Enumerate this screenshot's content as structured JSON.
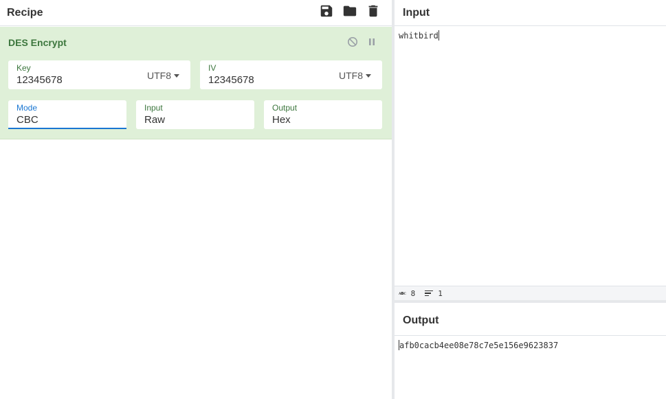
{
  "recipe": {
    "title": "Recipe",
    "icons": [
      "save-icon",
      "folder-icon",
      "trash-icon"
    ]
  },
  "operation": {
    "name": "DES Encrypt",
    "key": {
      "label": "Key",
      "value": "12345678",
      "encoding": "UTF8"
    },
    "iv": {
      "label": "IV",
      "value": "12345678",
      "encoding": "UTF8"
    },
    "mode": {
      "label": "Mode",
      "value": "CBC"
    },
    "input": {
      "label": "Input",
      "value": "Raw"
    },
    "output": {
      "label": "Output",
      "value": "Hex"
    }
  },
  "input_pane": {
    "title": "Input",
    "text": "whitbird",
    "stats": {
      "chars": "8",
      "lines": "1"
    }
  },
  "output_pane": {
    "title": "Output",
    "text": "afb0cacb4ee08e78c7e5e156e9623837"
  },
  "colors": {
    "operation_bg": "#dff0d8",
    "operation_title": "#3c763d",
    "active_field": "#1976d2"
  }
}
